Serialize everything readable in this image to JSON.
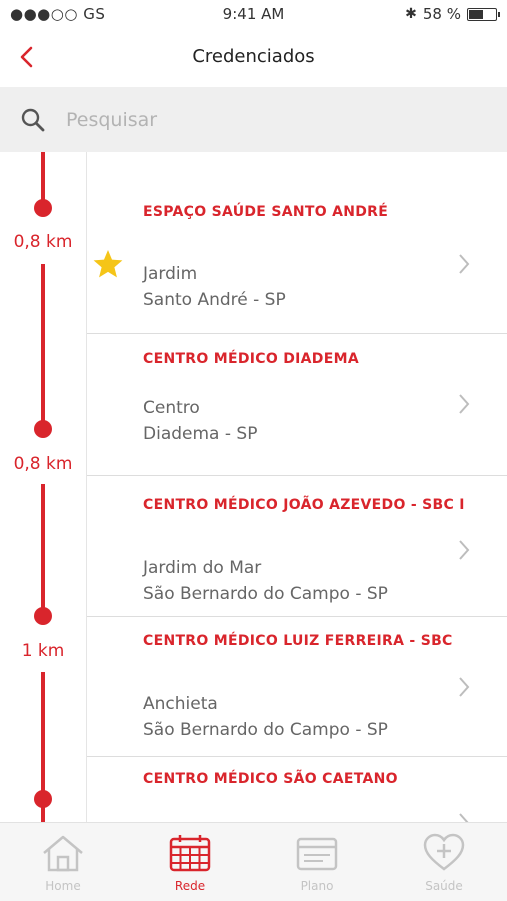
{
  "status_bar": {
    "carrier": "●●●○○ GS",
    "time": "9:41 AM",
    "battery": "58 %",
    "battery_level": 0.58
  },
  "header": {
    "title": "Credenciados"
  },
  "search": {
    "placeholder": "Pesquisar"
  },
  "timeline": {
    "distances": [
      "0,8 km",
      "0,8 km",
      "1 km"
    ]
  },
  "results": [
    {
      "name": "ESPAÇO SAÚDE SANTO ANDRÉ",
      "neighborhood": "Jardim",
      "city": "Santo André - SP",
      "favorite": true
    },
    {
      "name": "CENTRO MÉDICO DIADEMA",
      "neighborhood": "Centro",
      "city": "Diadema - SP",
      "favorite": false
    },
    {
      "name": "CENTRO MÉDICO JOÃO AZEVEDO - SBC I",
      "neighborhood": "Jardim do Mar",
      "city": "São Bernardo do Campo - SP",
      "favorite": false
    },
    {
      "name": "CENTRO MÉDICO LUIZ FERREIRA - SBC",
      "neighborhood": "Anchieta",
      "city": "São Bernardo do Campo - SP",
      "favorite": false
    },
    {
      "name": "CENTRO MÉDICO SÃO CAETANO",
      "neighborhood": "",
      "city": "",
      "favorite": false
    }
  ],
  "tabs": [
    {
      "label": "Home",
      "icon": "home-icon",
      "active": false
    },
    {
      "label": "Rede",
      "icon": "calendar-grid-icon",
      "active": true
    },
    {
      "label": "Plano",
      "icon": "card-icon",
      "active": false
    },
    {
      "label": "Saúde",
      "icon": "heart-plus-icon",
      "active": false
    }
  ],
  "colors": {
    "accent": "#d9252c",
    "star": "#f5c518",
    "inactive_tab": "#c4c4c4"
  }
}
